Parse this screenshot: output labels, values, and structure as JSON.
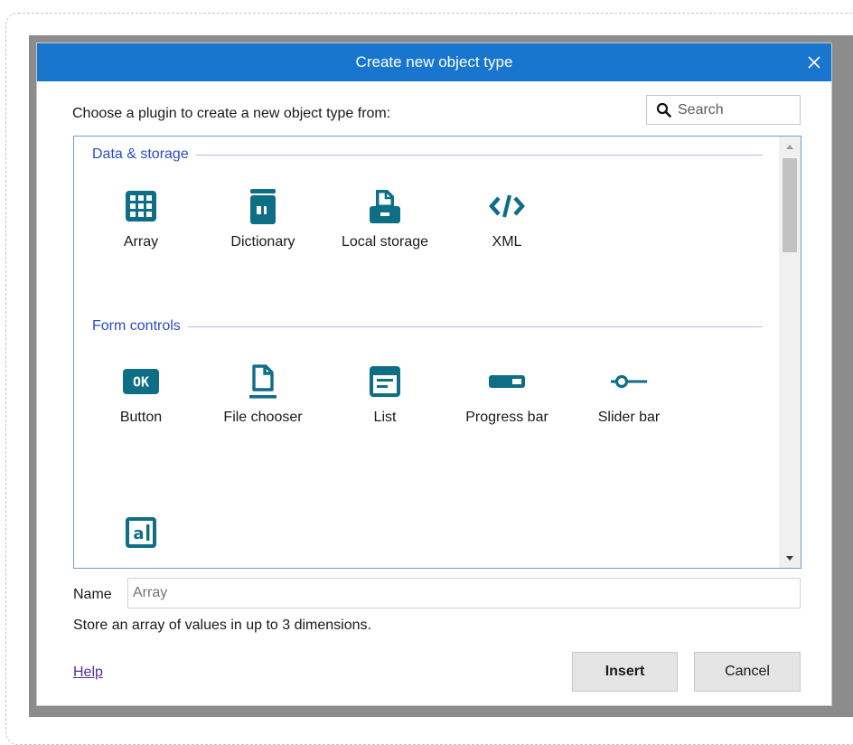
{
  "dialog": {
    "title": "Create new object type",
    "prompt": "Choose a plugin to create a new object type from:",
    "search": {
      "placeholder": "Search",
      "value": ""
    }
  },
  "accent_colors": {
    "titlebar": "#1976cf",
    "icon": "#0e6e86",
    "section_label": "#2a4cc8",
    "link": "#5b2d98"
  },
  "sections": [
    {
      "label": "Data & storage",
      "plugins": [
        {
          "name": "Array",
          "icon": "grid-icon",
          "selected": true
        },
        {
          "name": "Dictionary",
          "icon": "dictionary-icon"
        },
        {
          "name": "Local storage",
          "icon": "local-storage-icon"
        },
        {
          "name": "XML",
          "icon": "code-icon"
        }
      ]
    },
    {
      "label": "Form controls",
      "plugins": [
        {
          "name": "Button",
          "icon": "ok-button-icon"
        },
        {
          "name": "File chooser",
          "icon": "file-icon"
        },
        {
          "name": "List",
          "icon": "list-icon"
        },
        {
          "name": "Progress bar",
          "icon": "progress-bar-icon"
        },
        {
          "name": "Slider bar",
          "icon": "slider-icon"
        },
        {
          "name": "",
          "icon": "text-input-icon"
        }
      ]
    }
  ],
  "name_field": {
    "label": "Name",
    "placeholder": "Array",
    "value": ""
  },
  "description": "Store an array of values in up to 3 dimensions.",
  "help_link": "Help",
  "buttons": {
    "insert": "Insert",
    "cancel": "Cancel"
  }
}
